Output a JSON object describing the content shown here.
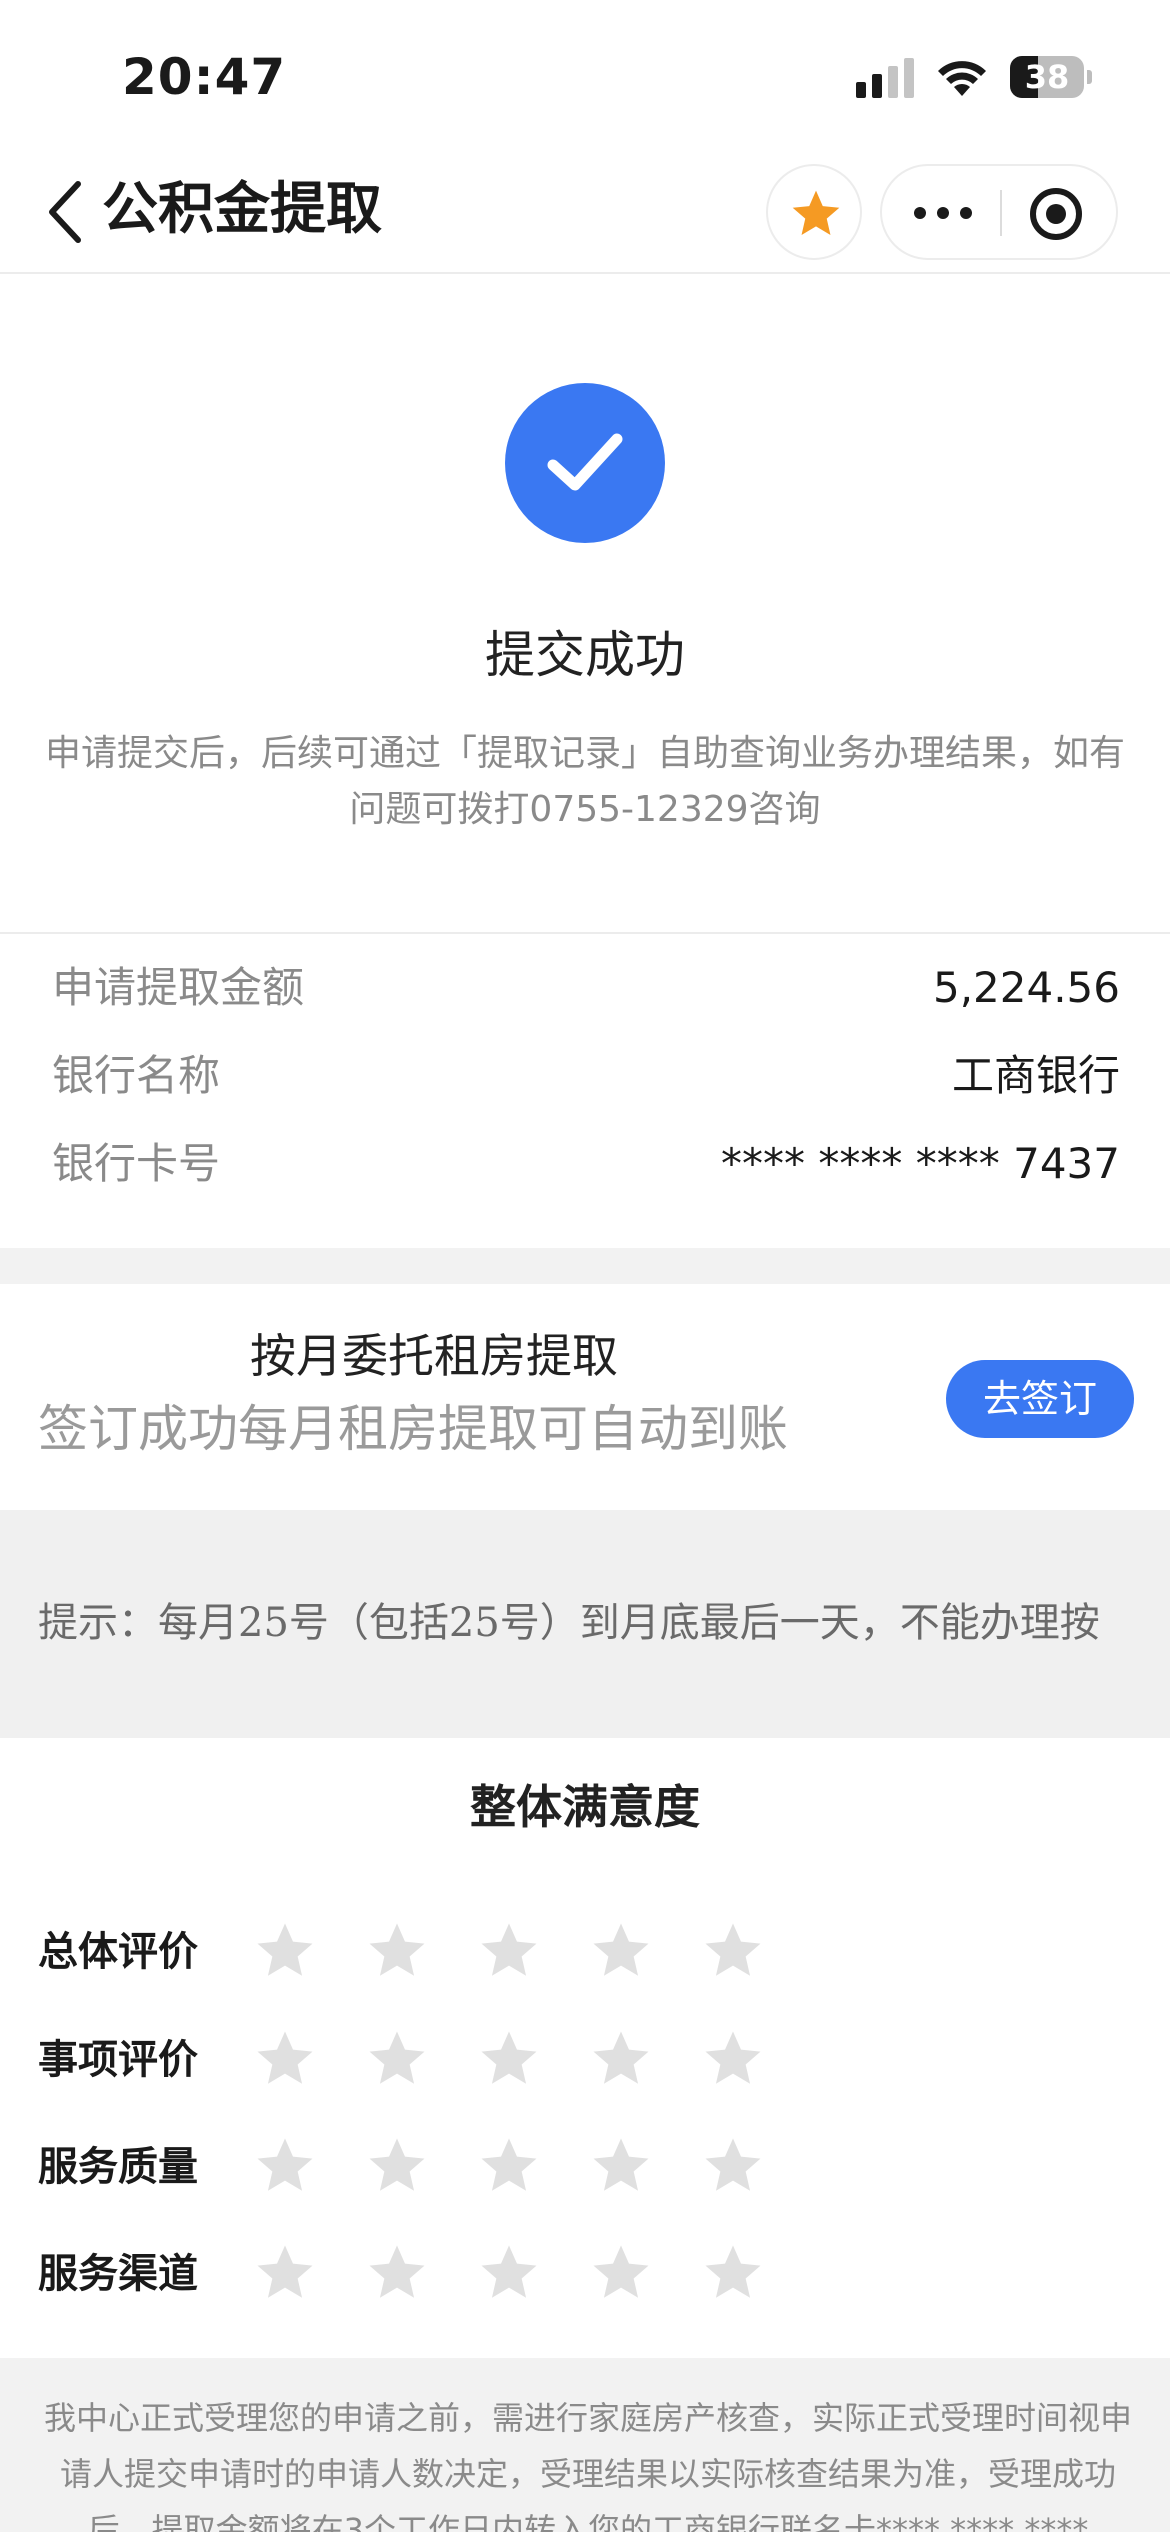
{
  "status_bar": {
    "time": "20:47",
    "battery_level": "38",
    "battery_fraction": 0.38
  },
  "nav": {
    "title": "公积金提取",
    "icons": {
      "back": "chevron-left-icon",
      "favorite": "star-icon",
      "more": "more-dots-icon",
      "close": "target-close-icon"
    },
    "favorite_color": "#f59a23"
  },
  "success": {
    "title": "提交成功",
    "description": "申请提交后，后续可通过「提取记录」自助查询业务办理结果，如有问题可拨打0755-12329咨询",
    "icon": "check-circle-icon",
    "accent_color": "#3a78f2"
  },
  "details": [
    {
      "label": "申请提取金额",
      "value": "5,224.56"
    },
    {
      "label": "银行名称",
      "value": "工商银行"
    },
    {
      "label": "银行卡号",
      "value": "**** **** **** 7437"
    }
  ],
  "entrust": {
    "title": "按月委托租房提取",
    "subtitle": "签订成功每月租房提取可自动到账",
    "button_label": "去签订"
  },
  "tip": {
    "text": "提示：每月25号（包括25号）到月底最后一天，不能办理按"
  },
  "satisfaction": {
    "title": "整体满意度",
    "ratings": [
      {
        "label": "总体评价",
        "stars_filled": 0,
        "stars_total": 5
      },
      {
        "label": "事项评价",
        "stars_filled": 0,
        "stars_total": 5
      },
      {
        "label": "服务质量",
        "stars_filled": 0,
        "stars_total": 5
      },
      {
        "label": "服务渠道",
        "stars_filled": 0,
        "stars_total": 5
      }
    ],
    "empty_star_color": "#e0e0e0"
  },
  "notice": {
    "text": "我中心正式受理您的申请之前，需进行家庭房产核查，实际正式受理时间视申请人提交申请时的申请人数决定，受理结果以实际核查结果为准，受理成功后，提取金额将在3个工作日内转入您的工商银行联名卡**** **** ****"
  }
}
